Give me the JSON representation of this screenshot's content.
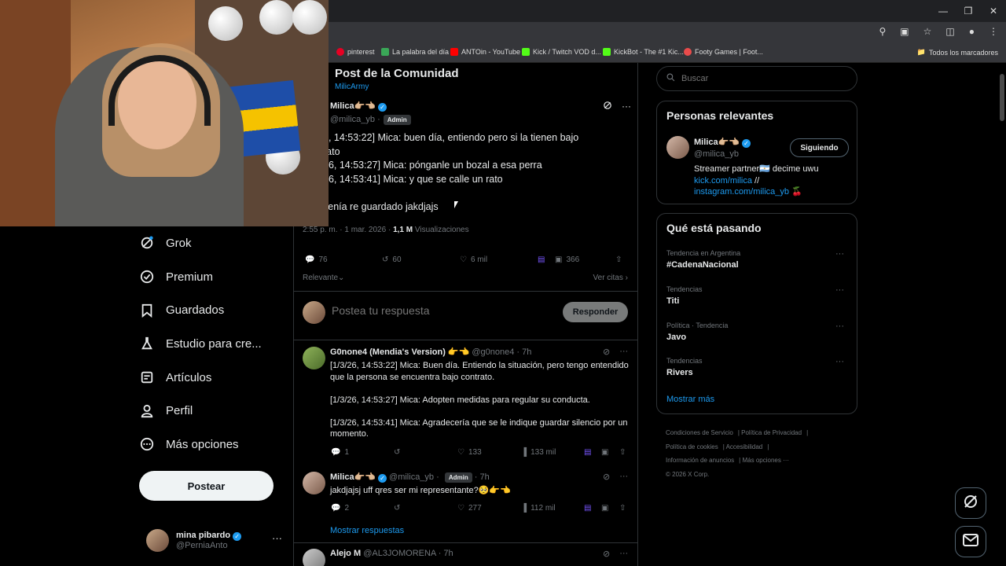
{
  "bookmarks": {
    "items": [
      {
        "label": "pinterest",
        "color": "#e60023"
      },
      {
        "label": "La palabra del día",
        "color": "#3aa757"
      },
      {
        "label": "ANTOin - YouTube",
        "color": "#ff0000"
      },
      {
        "label": "Kick / Twitch VOD d...",
        "color": "#53fc18"
      },
      {
        "label": "KickBot - The #1 Kic...",
        "color": "#53fc18"
      },
      {
        "label": "Footy Games | Foot...",
        "color": "#e94b4b"
      }
    ],
    "all_label": "Todos los marcadores"
  },
  "nav": {
    "items": [
      {
        "label": "Grok",
        "icon": "grok-icon"
      },
      {
        "label": "Premium",
        "icon": "premium-icon"
      },
      {
        "label": "Guardados",
        "icon": "bookmark-icon"
      },
      {
        "label": "Estudio para cre...",
        "icon": "flask-icon"
      },
      {
        "label": "Artículos",
        "icon": "article-icon"
      },
      {
        "label": "Perfil",
        "icon": "profile-icon"
      },
      {
        "label": "Más opciones",
        "icon": "more-circle-icon"
      }
    ],
    "post_button": "Postear"
  },
  "account": {
    "name": "mina pibardo",
    "handle": "@PerniaAnto"
  },
  "header": {
    "title": "Post de la Comunidad",
    "subtitle": "MilicArmy"
  },
  "op": {
    "name": "Milica👉🏼👈🏼",
    "handle": "@milica_yb",
    "sep": "·",
    "badge": "Admin",
    "lines": [
      "6, 14:53:22] Mica: buen día, entiendo pero si la tienen bajo",
      "rato",
      "26, 14:53:27] Mica: pónganle un bozal a esa perra",
      "26, 14:53:41] Mica: y que se calle un rato",
      "",
      "cenía re guardado jakdjajs"
    ],
    "time": "2:55 p. m. · 1 mar. 2026 ·",
    "views_count": "1,1 M",
    "views_label": "Visualizaciones",
    "replies": "76",
    "reposts": "60",
    "likes": "6 mil",
    "bookmarks": "366",
    "relevant": "Relevante",
    "quotes": "Ver citas"
  },
  "reply_box": {
    "placeholder": "Postea tu respuesta",
    "button": "Responder"
  },
  "replies": [
    {
      "name": "G0none4 (Mendia's Version) 👉👈",
      "handle": "@g0none4 · 7h",
      "body": [
        "[1/3/26, 14:53:22] Mica: Buen día. Entiendo la situación, pero tengo entendido que la persona se encuentra bajo contrato.",
        "[1/3/26, 14:53:27] Mica: Adopten medidas para regular su conducta.",
        "[1/3/26, 14:53:41] Mica: Agradecería que se le indique guardar silencio por un momento."
      ],
      "replies": "1",
      "reposts": "",
      "likes": "133",
      "views": "133 mil"
    },
    {
      "name": "Milica👉🏼👈🏼",
      "handle": "@milica_yb ·",
      "badge": "Admin",
      "time": "· 7h",
      "body": [
        "jakdjajsj uff qres ser mi representante?🥺👉👈"
      ],
      "replies": "2",
      "reposts": "",
      "likes": "277",
      "views": "112 mil",
      "show_more": "Mostrar respuestas"
    },
    {
      "name": "Alejo M",
      "handle": "@AL3JOMORENA · 7h"
    }
  ],
  "search": {
    "placeholder": "Buscar"
  },
  "relevant_people": {
    "title": "Personas relevantes",
    "name": "Milica👉🏼👈🏼",
    "handle": "@milica_yb",
    "follow": "Siguiendo",
    "bio": "Streamer partner🇦🇷 decime uwu",
    "link1": "kick.com/milica",
    "link_sep": " //",
    "link2": "instagram.com/milica_yb",
    "link2_suffix": "🍒"
  },
  "trends": {
    "title": "Qué está pasando",
    "items": [
      {
        "label": "Tendencia en Argentina",
        "name": "#CadenaNacional"
      },
      {
        "label": "Tendencias",
        "name": "Titi"
      },
      {
        "label": "Política · Tendencia",
        "name": "Javo"
      },
      {
        "label": "Tendencias",
        "name": "Rivers"
      }
    ],
    "show_more": "Mostrar más"
  },
  "footer": {
    "links": [
      "Condiciones de Servicio",
      "Política de Privacidad",
      "Política de cookies",
      "Accesibilidad",
      "Información de anuncios",
      "Más opciones ···"
    ],
    "copyright": "© 2026 X Corp."
  },
  "colors": {
    "accent": "#1d9bf0",
    "background": "#000000",
    "border": "#2f3336",
    "muted": "#71767b"
  }
}
